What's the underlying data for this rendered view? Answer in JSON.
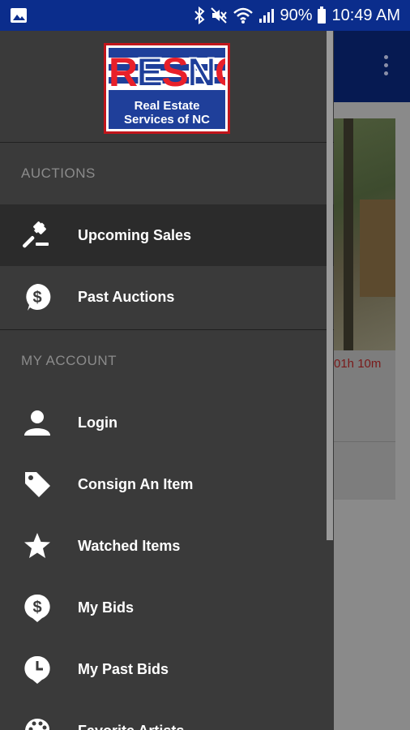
{
  "status_bar": {
    "battery": "90%",
    "time": "10:49 AM",
    "bg_color": "#0b2d8c"
  },
  "logo": {
    "letters": "RESNC",
    "line1": "Real Estate",
    "line2": "Services of NC"
  },
  "background": {
    "countdown": "01h 10m"
  },
  "drawer": {
    "sections": [
      {
        "title": "AUCTIONS",
        "items": [
          {
            "label": "Upcoming Sales",
            "icon": "gavel-icon",
            "active": true
          },
          {
            "label": "Past Auctions",
            "icon": "dollar-bubble-icon"
          }
        ]
      },
      {
        "title": "MY ACCOUNT",
        "items": [
          {
            "label": "Login",
            "icon": "person-icon"
          },
          {
            "label": "Consign An Item",
            "icon": "tag-icon"
          },
          {
            "label": "Watched Items",
            "icon": "star-icon"
          },
          {
            "label": "My Bids",
            "icon": "dollar-bubble-icon"
          },
          {
            "label": "My Past Bids",
            "icon": "clock-bubble-icon"
          },
          {
            "label": "Favorite Artists",
            "icon": "palette-icon"
          }
        ]
      }
    ]
  },
  "colors": {
    "drawer_bg": "#3a3a3a",
    "active_item_bg": "#2b2b2b",
    "section_title": "#8b8b8b",
    "toolbar_dim": "#061a52",
    "logo_red": "#c0151b",
    "logo_blue": "#1f3f9a"
  }
}
